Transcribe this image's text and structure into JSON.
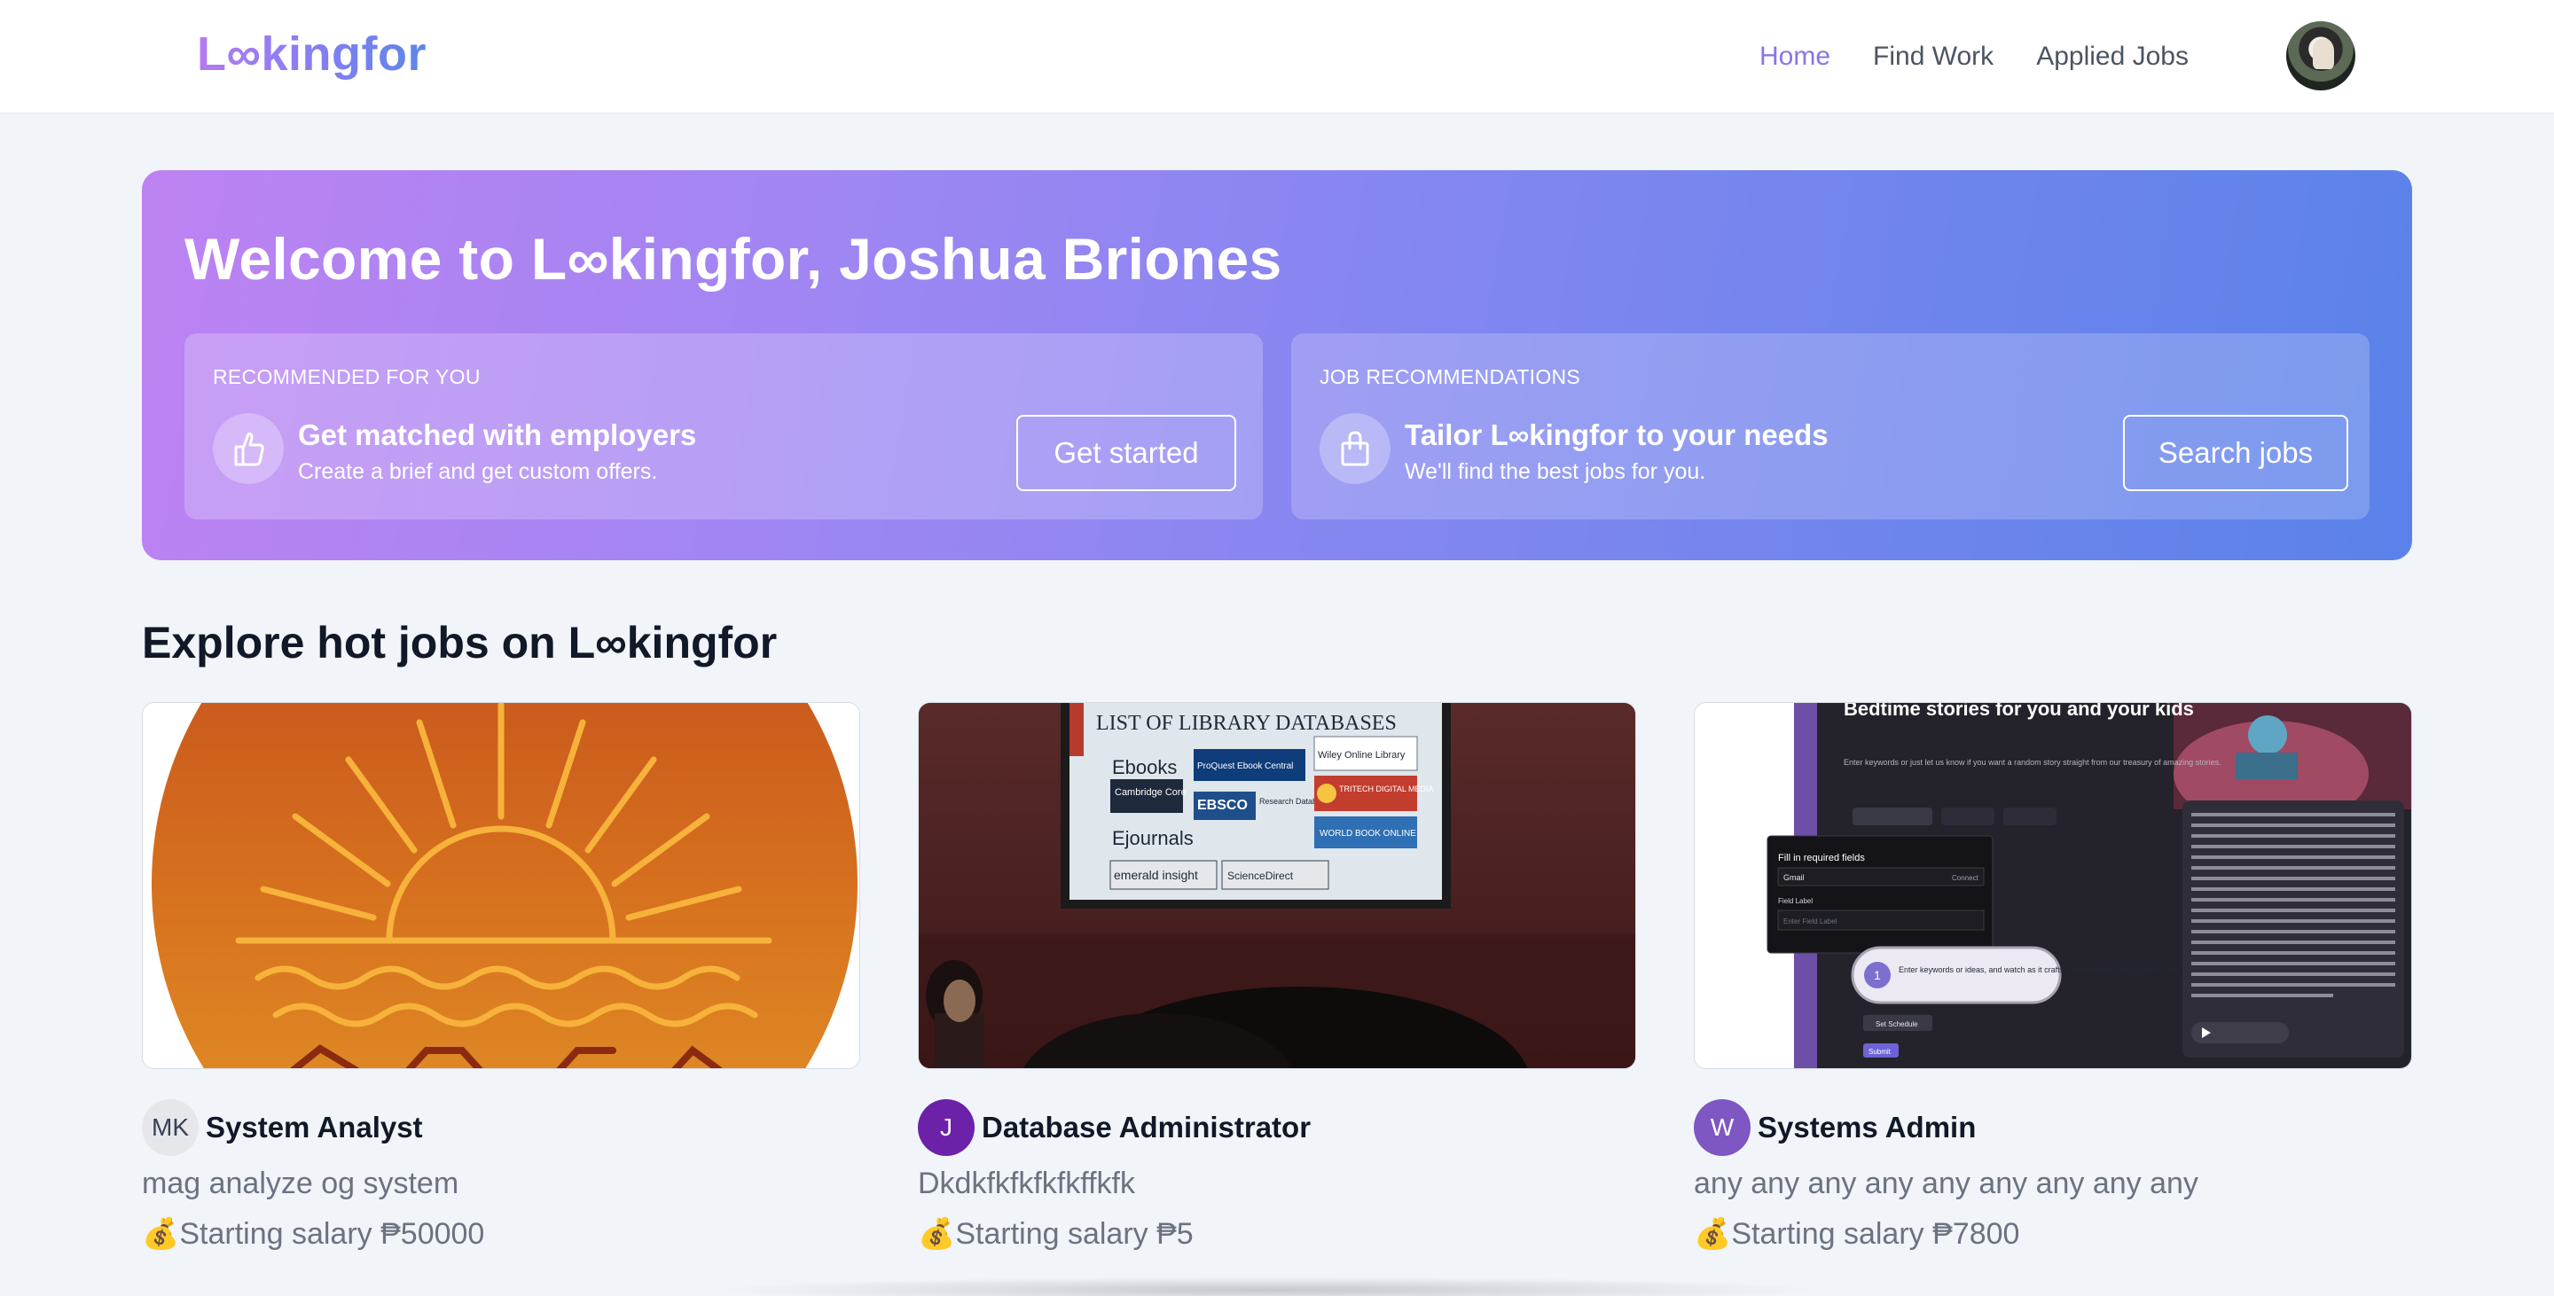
{
  "nav": {
    "logo": "L∞kingfor",
    "links": [
      {
        "label": "Home",
        "active": true
      },
      {
        "label": "Find Work",
        "active": false
      },
      {
        "label": "Applied Jobs",
        "active": false
      }
    ]
  },
  "hero": {
    "title": "Welcome to L∞kingfor, Joshua Briones",
    "cards": [
      {
        "kicker": "RECOMMENDED FOR YOU",
        "heading": "Get matched with employers",
        "sub": "Create a brief and get custom offers.",
        "button": "Get started",
        "icon": "thumbs-up-icon"
      },
      {
        "kicker": "JOB RECOMMENDATIONS",
        "heading": "Tailor L∞kingfor to your needs",
        "sub": "We'll find the best jobs for you.",
        "button": "Search jobs",
        "icon": "shopping-bag-icon"
      }
    ]
  },
  "section": {
    "title": "Explore hot jobs on L∞kingfor"
  },
  "jobs": [
    {
      "initials": "MK",
      "title": "System Analyst",
      "description": "mag analyze og system",
      "salary_icon": "💰",
      "salary": "Starting salary ₱50000",
      "avatar_bg": "#e5e7eb",
      "avatar_fg": "#374151"
    },
    {
      "initials": "J",
      "title": "Database Administrator",
      "description": "Dkdkfkfkfkfkffkfk",
      "salary_icon": "💰",
      "salary": "Starting salary ₱5",
      "avatar_bg": "#6b21a8",
      "avatar_fg": "#ffffff"
    },
    {
      "initials": "W",
      "title": "Systems Admin",
      "description": "any any any any any any any any any",
      "salary_icon": "💰",
      "salary": "Starting salary ₱7800",
      "avatar_bg": "#7e57c2",
      "avatar_fg": "#ffffff"
    }
  ],
  "job_images": {
    "library": {
      "header": "LIST OF LIBRARY DATABASES",
      "ebooks": "Ebooks",
      "ejournals": "Ejournals",
      "items": [
        "Cambridge Core",
        "ProQuest Ebook Central",
        "EBSCO",
        "Research Databases",
        "Wiley Online Library",
        "TRITECH DIGITAL MEDIA",
        "WORLD BOOK ONLINE",
        "emerald insight",
        "ScienceDirect"
      ]
    },
    "stories": {
      "heading": "Bedtime stories for you and your kids",
      "sub": "Enter keywords or just let us know if you want a random story straight from our treasury of amazing stories.",
      "dialog_title": "Fill in required fields",
      "gmail": "Gmail",
      "connect": "Connect",
      "field_label": "Field Label",
      "field_placeholder": "Enter Field Label",
      "tip_number": "1",
      "tip_text": "Enter keywords or ideas, and watch as it crafts a personalized story just for you.",
      "set_schedule": "Set Schedule",
      "submit": "Submit"
    }
  }
}
